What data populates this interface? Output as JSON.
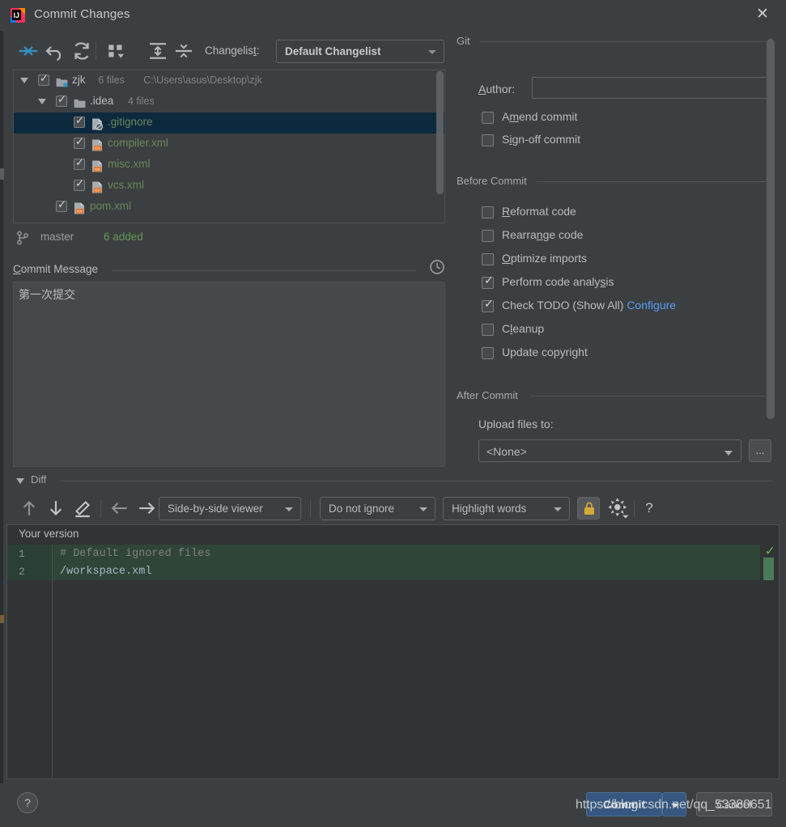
{
  "window": {
    "title": "Commit Changes",
    "app_icon": "intellij-idea-icon",
    "close_icon": "close-icon"
  },
  "toolbar": {
    "icons": [
      {
        "name": "show-diff-icon",
        "glyph": "arrows-in"
      },
      {
        "name": "rollback-icon",
        "glyph": "undo"
      },
      {
        "name": "refresh-icon",
        "glyph": "refresh"
      },
      {
        "name": "group-by-icon",
        "glyph": "group"
      },
      {
        "name": "expand-all-icon",
        "glyph": "expand"
      },
      {
        "name": "collapse-all-icon",
        "glyph": "collapse"
      }
    ],
    "changelist_label": "Changelist:",
    "changelist_mnemonic": "t",
    "changelist_value": "Default Changelist"
  },
  "tree": {
    "rows": [
      {
        "indent": 0,
        "twisty": true,
        "checked": true,
        "icon": "module-folder-icon",
        "name": "zjk",
        "name_color": "dir",
        "meta": "6 files",
        "meta2": "C:\\Users\\asus\\Desktop\\zjk",
        "selected": false
      },
      {
        "indent": 1,
        "twisty": true,
        "checked": true,
        "icon": "folder-icon",
        "name": ".idea",
        "name_color": "dir",
        "meta": "4 files",
        "meta2": "",
        "selected": false
      },
      {
        "indent": 2,
        "twisty": false,
        "checked": true,
        "icon": "gitignore-file-icon",
        "name": ".gitignore",
        "name_color": "grn",
        "meta": "",
        "meta2": "",
        "selected": true
      },
      {
        "indent": 2,
        "twisty": false,
        "checked": true,
        "icon": "xml-file-icon",
        "name": "compiler.xml",
        "name_color": "grn",
        "meta": "",
        "meta2": "",
        "selected": false
      },
      {
        "indent": 2,
        "twisty": false,
        "checked": true,
        "icon": "xml-file-icon",
        "name": "misc.xml",
        "name_color": "grn",
        "meta": "",
        "meta2": "",
        "selected": false
      },
      {
        "indent": 2,
        "twisty": false,
        "checked": true,
        "icon": "xml-file-icon",
        "name": "vcs.xml",
        "name_color": "grn",
        "meta": "",
        "meta2": "",
        "selected": false
      },
      {
        "indent": 1,
        "twisty": false,
        "checked": true,
        "icon": "xml-file-icon",
        "name": "pom.xml",
        "name_color": "grn",
        "meta": "",
        "meta2": "",
        "selected": false
      }
    ]
  },
  "branch_bar": {
    "icon": "branch-icon",
    "branch": "master",
    "status": "6 added"
  },
  "commit_message": {
    "title": "Commit Message",
    "mnemonic": "C",
    "history_icon": "clock-icon",
    "value": "第一次提交"
  },
  "git_section": {
    "title": "Git",
    "author_label": "Author:",
    "author_mnemonic": "A",
    "author_value": "",
    "checkboxes": [
      {
        "label": "Amend commit",
        "mnemonic": "m",
        "checked": false,
        "name": "amend-commit"
      },
      {
        "label": "Sign-off commit",
        "mnemonic": "i",
        "checked": false,
        "name": "sign-off-commit"
      }
    ]
  },
  "before_commit": {
    "title": "Before Commit",
    "checkboxes": [
      {
        "label": "Reformat code",
        "mnemonic": "R",
        "checked": false,
        "name": "reformat-code"
      },
      {
        "label": "Rearrange code",
        "mnemonic": "n",
        "checked": false,
        "name": "rearrange-code"
      },
      {
        "label": "Optimize imports",
        "mnemonic": "O",
        "checked": false,
        "name": "optimize-imports"
      },
      {
        "label": "Perform code analysis",
        "mnemonic": "s",
        "checked": true,
        "name": "perform-code-analysis"
      },
      {
        "label": "Check TODO (Show All)",
        "mnemonic": "",
        "checked": true,
        "name": "check-todo",
        "link": "Configure"
      },
      {
        "label": "Cleanup",
        "mnemonic": "l",
        "checked": false,
        "name": "cleanup"
      },
      {
        "label": "Update copyright",
        "mnemonic": "",
        "checked": false,
        "name": "update-copyright"
      }
    ]
  },
  "after_commit": {
    "title": "After Commit",
    "upload_label": "Upload files to:",
    "upload_value": "<None>",
    "browse_label": "..."
  },
  "diff": {
    "title": "Diff",
    "toolbar": {
      "icons": [
        {
          "name": "previous-difference-icon",
          "glyph": "arrow-up"
        },
        {
          "name": "next-difference-icon",
          "glyph": "arrow-down"
        },
        {
          "name": "edit-source-icon",
          "glyph": "pencil"
        },
        {
          "name": "accept-left-icon",
          "glyph": "arrow-left"
        },
        {
          "name": "accept-right-icon",
          "glyph": "arrow-right"
        }
      ],
      "viewer_mode": "Side-by-side viewer",
      "ignore_mode": "Do not ignore",
      "highlight_mode": "Highlight words",
      "lock_icon": "lock-icon",
      "settings_icon": "gear-icon",
      "help_icon": "question-icon"
    },
    "pane_title": "Your version",
    "lines": [
      {
        "num": "1",
        "text": "# Default ignored files",
        "style": "comment"
      },
      {
        "num": "2",
        "text": "/workspace.xml",
        "style": "text"
      }
    ],
    "marker_icon": "check-icon"
  },
  "bottom": {
    "help_label": "?",
    "commit_label": "Commit",
    "commit_dropdown_icon": "chevron-down-icon",
    "cancel_label": "Cancel"
  },
  "watermark": "https://blog.csdn.net/qq_53380651",
  "colors": {
    "background": "#3c3f41",
    "selection": "#0d293e",
    "added_file": "#6a8759",
    "accent_blue": "#365880",
    "link_blue": "#589df6",
    "diff_added_bg": "#2f4538"
  }
}
